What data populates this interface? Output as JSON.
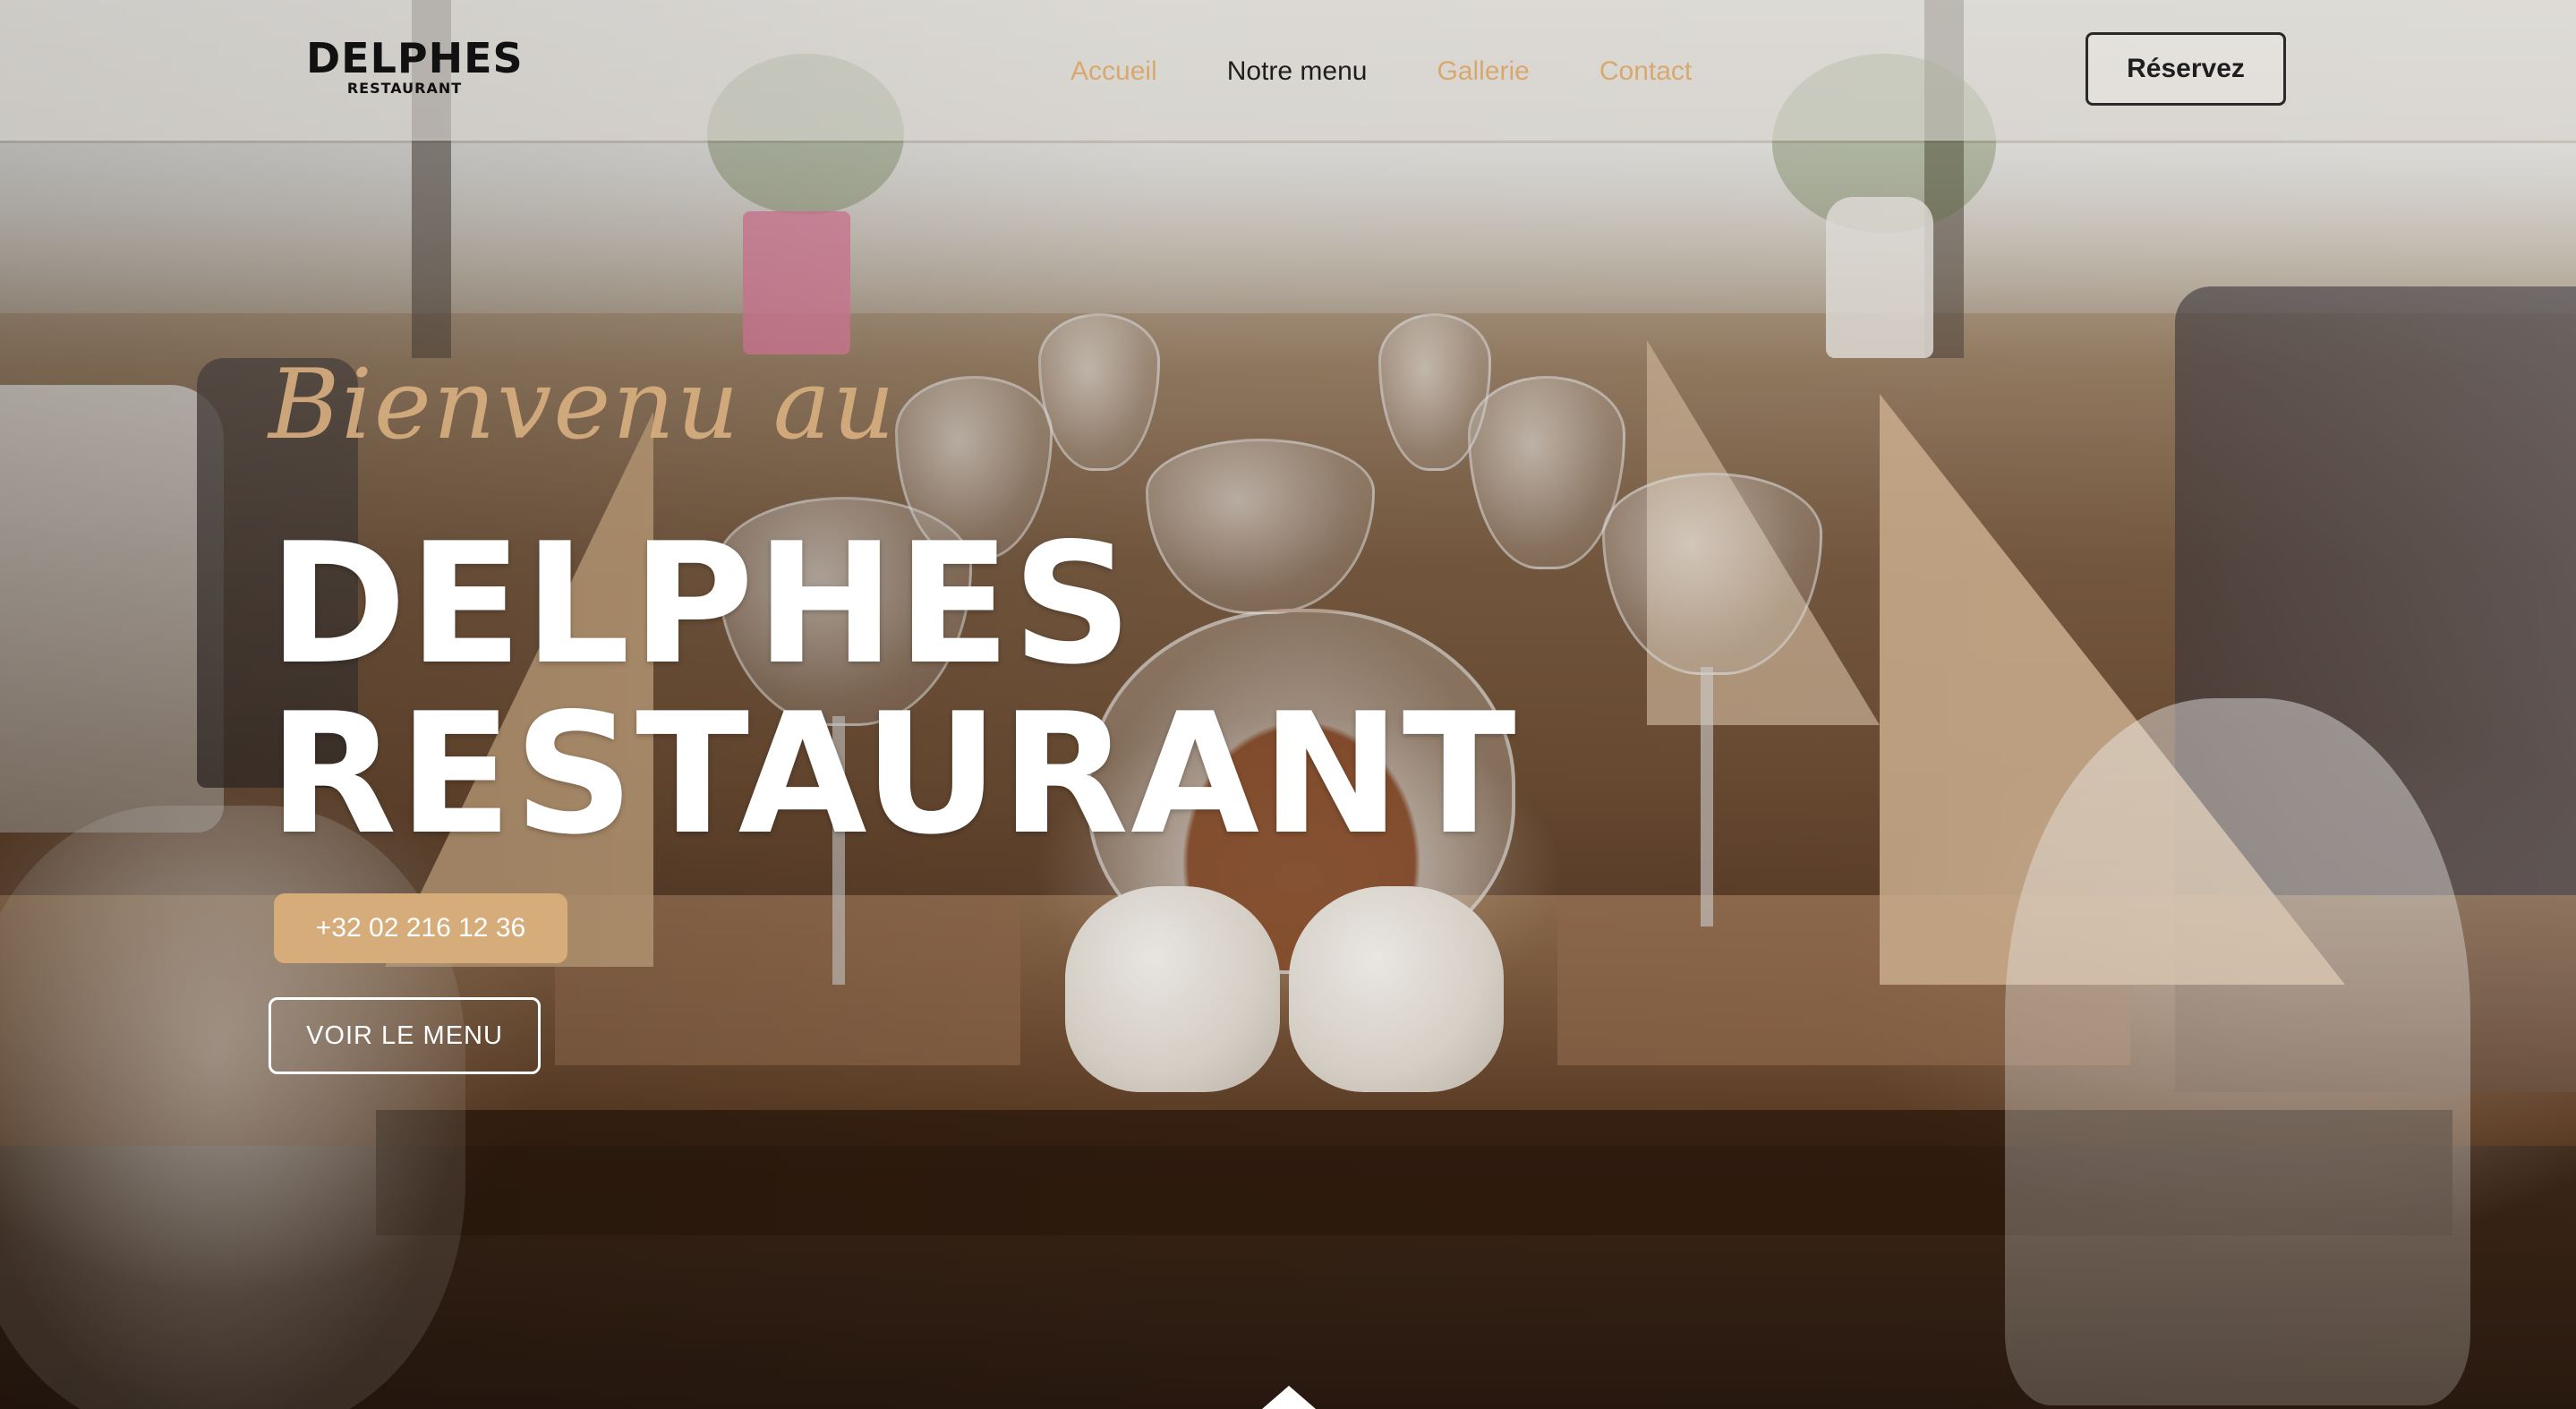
{
  "header": {
    "logo": {
      "main": "DELPHES",
      "sub": "RESTAURANT"
    },
    "nav": [
      {
        "label": "Accueil",
        "active": false
      },
      {
        "label": "Notre menu",
        "active": true
      },
      {
        "label": "Gallerie",
        "active": false
      },
      {
        "label": "Contact",
        "active": false
      }
    ],
    "reserve_label": "Réservez"
  },
  "hero": {
    "welcome": "Bienvenu au",
    "title_line1": "DELPHES",
    "title_line2": "RESTAURANT",
    "phone_label": "+32 02 216 12 36",
    "menu_label": "VOIR LE MENU"
  },
  "icons": {
    "scroll": "chevron-up-icon"
  },
  "colors": {
    "accent": "#d6ac7a",
    "nav_inactive": "#d8a86f",
    "nav_active": "#1e1e1e",
    "header_bg": "#ebe9e6"
  }
}
